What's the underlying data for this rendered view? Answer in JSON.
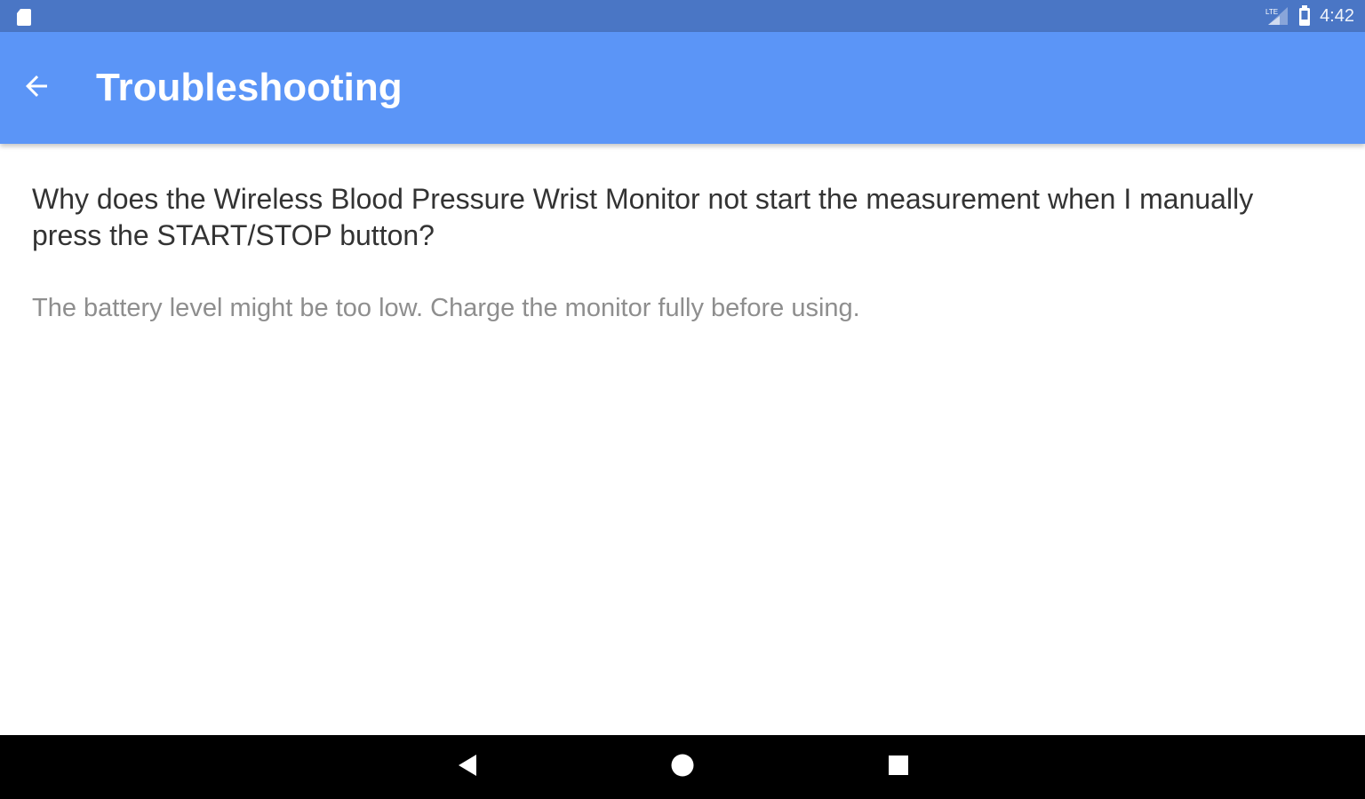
{
  "status_bar": {
    "time": "4:42",
    "icons": [
      "sd-card-icon",
      "signal-icon",
      "battery-icon"
    ],
    "background_color": "#4a76c5"
  },
  "app_bar": {
    "title": "Troubleshooting",
    "back_icon": "arrow-back-icon",
    "background_color": "#5b95f7"
  },
  "content": {
    "question": "Why does the Wireless Blood Pressure Wrist Monitor not start the measurement when I manually press the START/STOP button?",
    "answer": "The battery level might be too low. Charge the monitor fully before using."
  },
  "navigation_bar": {
    "buttons": [
      "nav-back-icon",
      "nav-home-icon",
      "nav-recents-icon"
    ],
    "background_color": "#000000"
  }
}
